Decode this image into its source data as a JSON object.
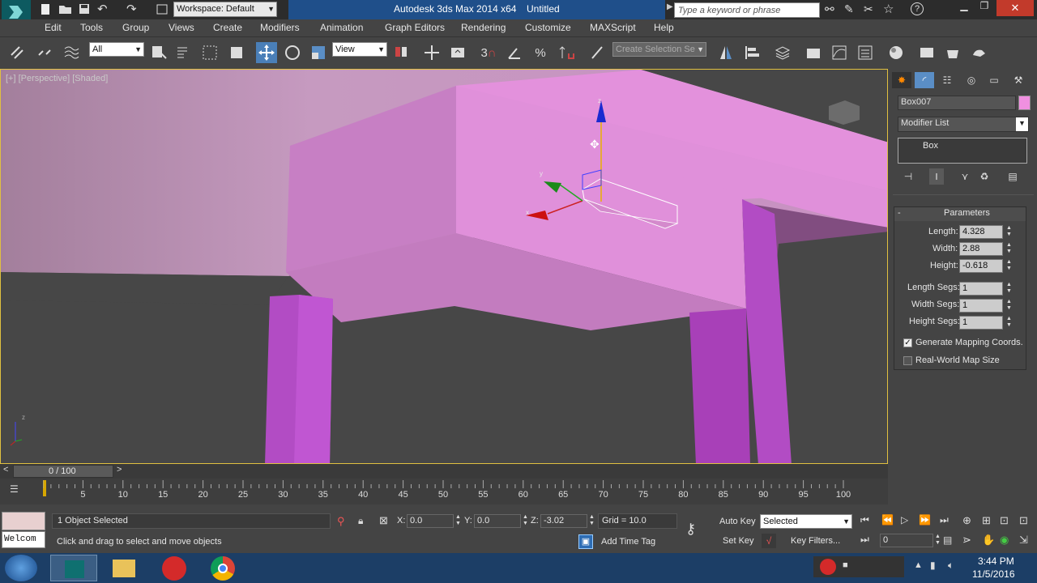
{
  "window": {
    "title": "Autodesk 3ds Max 2014 x64",
    "document": "Untitled",
    "workspace": "Workspace: Default",
    "search_placeholder": "Type a keyword or phrase"
  },
  "menu": [
    "Edit",
    "Tools",
    "Group",
    "Views",
    "Create",
    "Modifiers",
    "Animation",
    "Graph Editors",
    "Rendering",
    "Customize",
    "MAXScript",
    "Help"
  ],
  "toolbar": {
    "filter": "All",
    "ref_coord": "View",
    "snap_number": "3",
    "selection_set_placeholder": "Create Selection Se"
  },
  "viewport": {
    "label": "[+] [Perspective] [Shaded]",
    "gizmo": {
      "x": "x",
      "y": "y",
      "z": "z"
    },
    "axis_tripod": {
      "y": "y",
      "z": "z",
      "x": "x"
    }
  },
  "command_panel": {
    "object_name": "Box007",
    "object_color": "#f090e0",
    "modifier_list": "Modifier List",
    "stack_item": "Box",
    "rollout_title": "Parameters",
    "params": [
      {
        "label": "Length:",
        "value": "4.328"
      },
      {
        "label": "Width:",
        "value": "2.88"
      },
      {
        "label": "Height:",
        "value": "-0.618"
      },
      {
        "label": "Length Segs:",
        "value": "1"
      },
      {
        "label": "Width Segs:",
        "value": "1"
      },
      {
        "label": "Height Segs:",
        "value": "1"
      }
    ],
    "checkboxes": [
      {
        "label": "Generate Mapping Coords.",
        "checked": true
      },
      {
        "label": "Real-World Map Size",
        "checked": false
      }
    ]
  },
  "timeline": {
    "frame": "0 / 100",
    "ticks": [
      "5",
      "10",
      "15",
      "20",
      "25",
      "30",
      "35",
      "40",
      "45",
      "50",
      "55",
      "60",
      "65",
      "70",
      "75",
      "80",
      "85",
      "90",
      "95",
      "100"
    ]
  },
  "status": {
    "script_text": "Welcom",
    "selection": "1 Object Selected",
    "prompt": "Click and drag to select and move objects",
    "x_label": "X:",
    "x": "0.0",
    "y_label": "Y:",
    "y": "0.0",
    "z_label": "Z:",
    "z": "-3.02",
    "grid": "Grid = 10.0",
    "add_time_tag": "Add Time Tag",
    "auto_key": "Auto Key",
    "set_key": "Set Key",
    "key_mode": "Selected",
    "key_filters": "Key Filters...",
    "current_frame": "0"
  },
  "taskbar": {
    "time": "3:44 PM",
    "date": "11/5/2016"
  },
  "colors": {
    "pink_top": "#e08ad8",
    "pink_side": "#c878be",
    "leg": "#b048c0",
    "ui_bg": "#444444",
    "taskbar": "#1c3e66"
  }
}
